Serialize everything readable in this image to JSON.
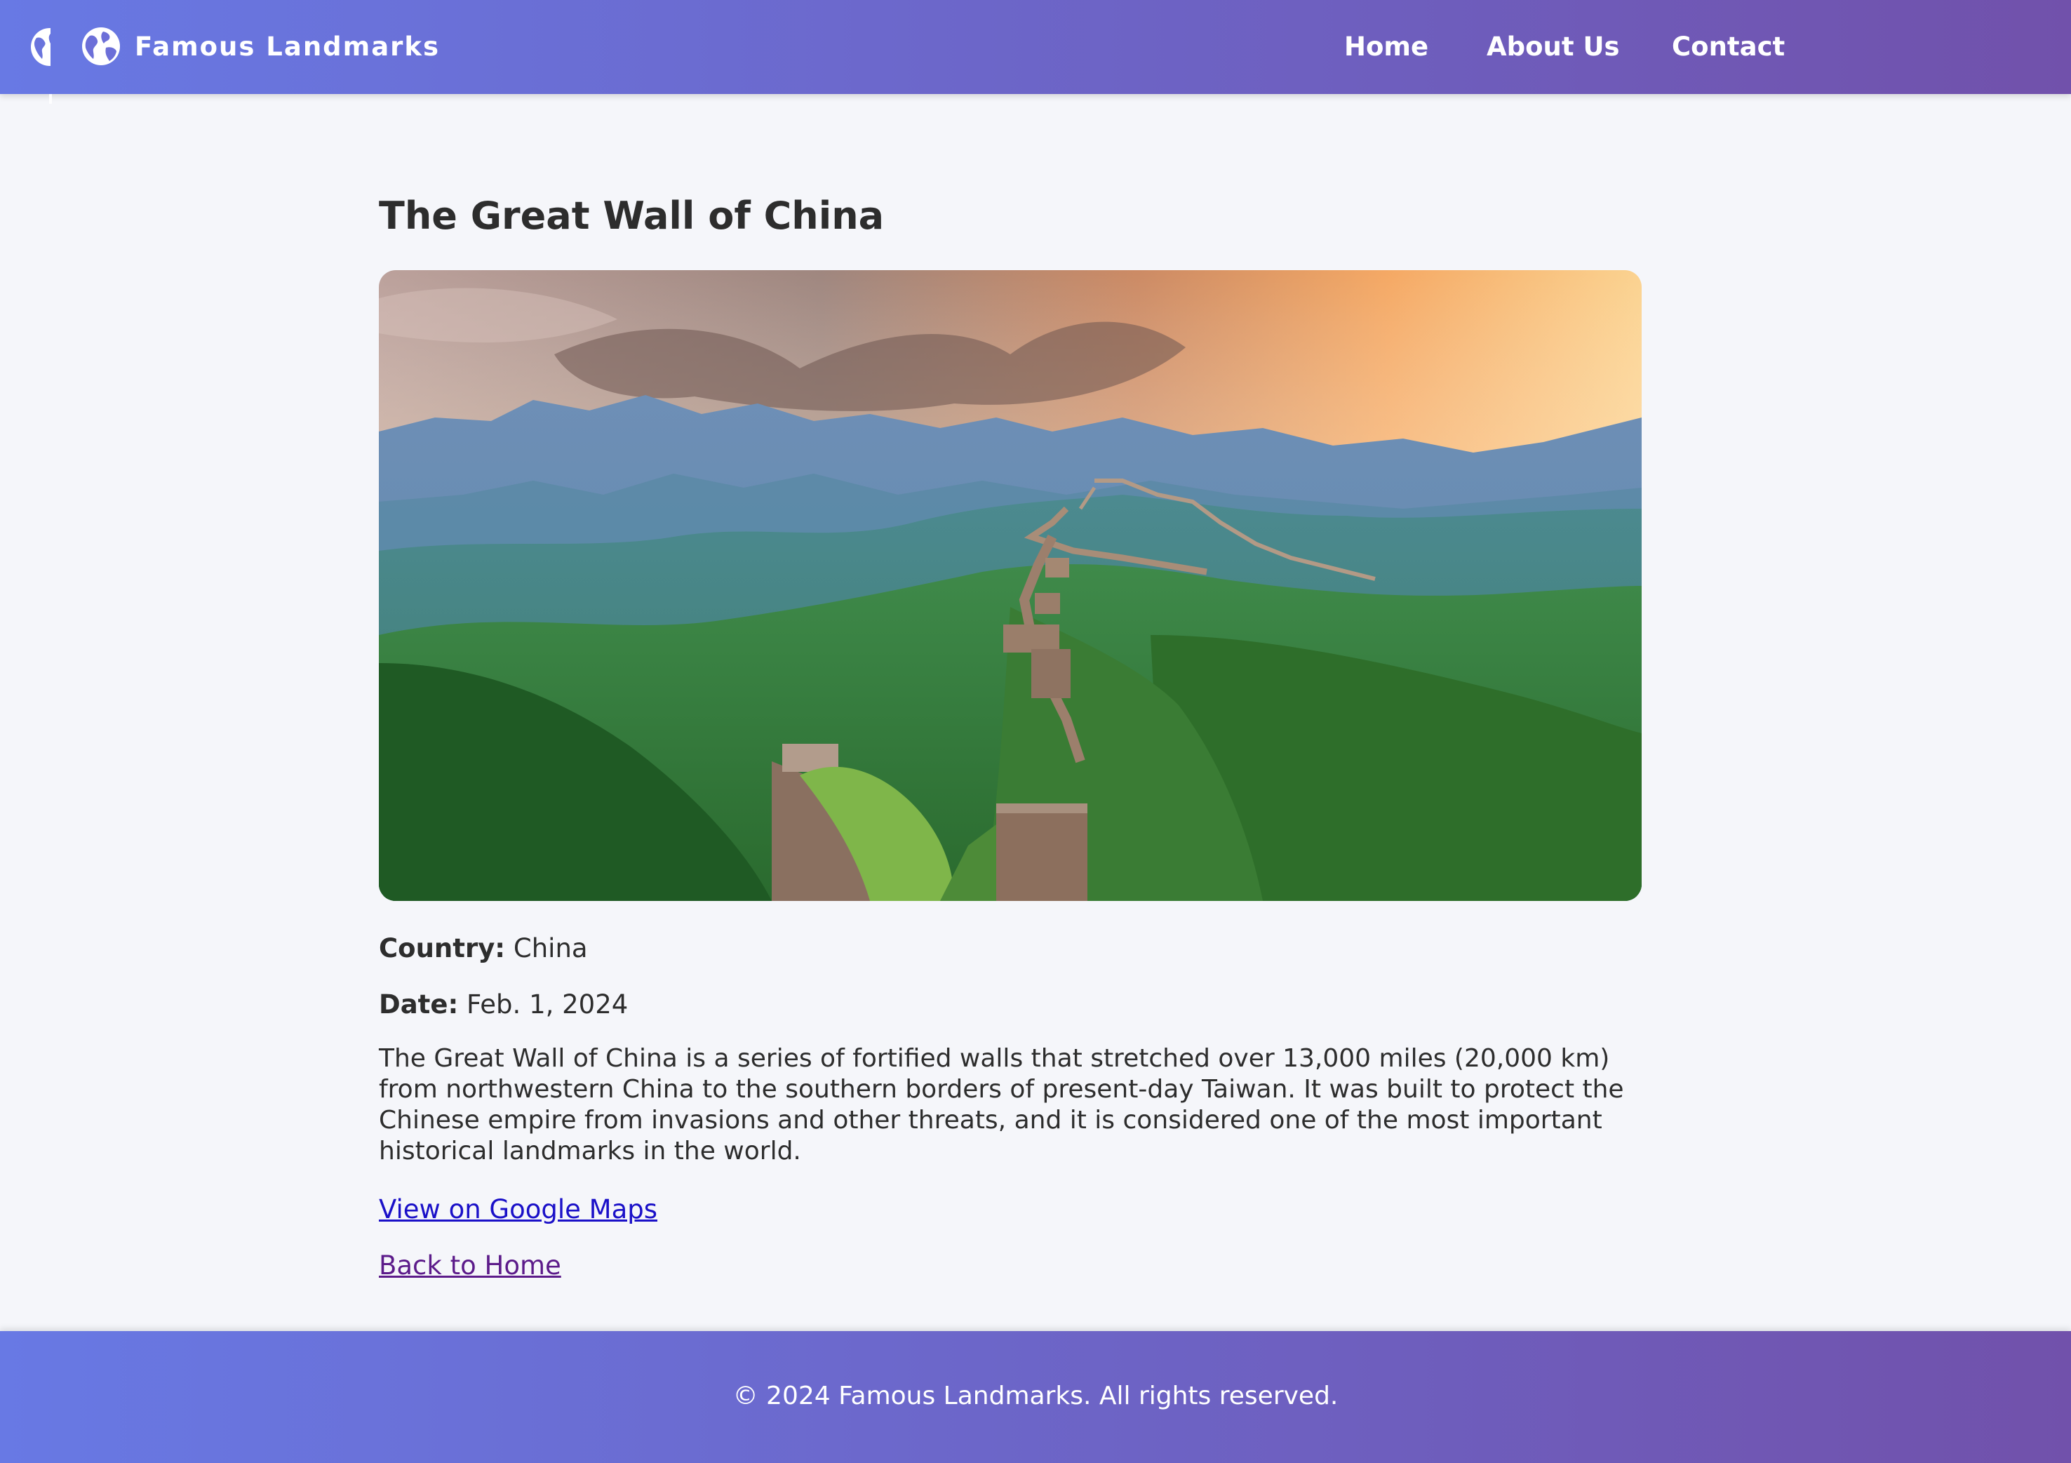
{
  "header": {
    "brand": "Famous Landmarks",
    "brand_icon": "globe-icon",
    "nav": [
      "Home",
      "About Us",
      "Contact"
    ]
  },
  "landmark": {
    "title": "The Great Wall of China",
    "image_alt": "Great Wall of China winding over green mountains at sunset",
    "country_label": "Country:",
    "country": "China",
    "date_label": "Date:",
    "date": "Feb. 1, 2024",
    "description": "The Great Wall of China is a series of fortified walls that stretched over 13,000 miles (20,000 km) from northwestern China to the southern borders of present-day Taiwan. It was built to protect the Chinese empire from invasions and other threats, and it is considered one of the most important historical landmarks in the world.",
    "maps_link": "View on Google Maps",
    "back_link": "Back to Home"
  },
  "footer": {
    "copyright": "© 2024 Famous Landmarks. All rights reserved."
  },
  "colors": {
    "header_gradient_start": "#6879e4",
    "header_gradient_end": "#7151ab",
    "maps_link": "#1a10c8",
    "back_link": "#5c1b8a",
    "background": "#f5f6fa"
  }
}
